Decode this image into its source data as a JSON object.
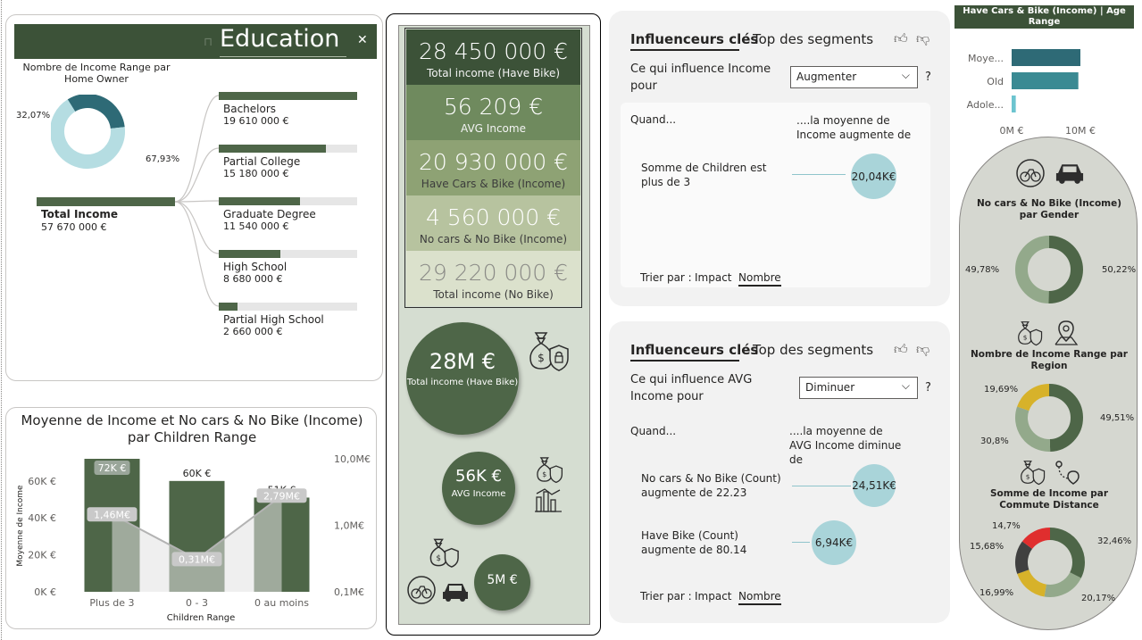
{
  "colors": {
    "dark_green": "#4e6648",
    "header_green": "#3c5238",
    "light_blue": "#b5dde2",
    "teal": "#2e6a76",
    "sage": "#93a98b",
    "gold": "#d7b22a",
    "charcoal": "#404040",
    "red": "#e02e2e"
  },
  "decomp": {
    "title": "Education",
    "subtitle": "Nombre de Income Range par Home Owner",
    "donut_left_pct": "32,07%",
    "donut_right_pct": "67,93%",
    "donut": [
      32.07,
      67.93
    ],
    "root": {
      "label": "Total Income",
      "value": "57 670 000 €"
    },
    "children": [
      {
        "label": "Bachelors",
        "value": "19 610 000 €",
        "fraction": 1.0
      },
      {
        "label": "Partial College",
        "value": "15 180 000 €",
        "fraction": 0.774
      },
      {
        "label": "Graduate Degree",
        "value": "11 540 000 €",
        "fraction": 0.588
      },
      {
        "label": "High School",
        "value": "8 680 000 €",
        "fraction": 0.443
      },
      {
        "label": "Partial High School",
        "value": "2 660 000 €",
        "fraction": 0.136
      }
    ],
    "icons": [
      "lock-icon",
      "close-icon"
    ]
  },
  "combo": {
    "title_line1": "Moyenne de Income et No cars & No Bike (Income)",
    "title_line2": "par Children Range",
    "ylabel": "Moyenne de Income",
    "xlabel": "Children Range",
    "left_ticks": [
      "60K €",
      "40K €",
      "20K €",
      "0K €"
    ],
    "right_ticks": [
      "10,0M€",
      "1,0M€",
      "0,1M€"
    ]
  },
  "chart_data": {
    "type": "bar",
    "title": "Moyenne de Income et No cars & No Bike (Income) par Children Range",
    "xlabel": "Children Range",
    "ylabel": "Moyenne de Income",
    "categories": [
      "Plus de 3",
      "0 - 3",
      "0 au moins"
    ],
    "series": [
      {
        "name": "Moyenne de Income",
        "values": [
          72000,
          60000,
          51000
        ],
        "labels": [
          "72K €",
          "60K €",
          "51K €"
        ]
      },
      {
        "name": "No cars & No Bike (Income)",
        "values": [
          1460000,
          310000,
          2790000
        ],
        "labels": [
          "1,46M€",
          "0,31M€",
          "2,79M€"
        ],
        "scale": "log"
      }
    ],
    "ylim": [
      0,
      72000
    ],
    "y2lim": [
      100000,
      10000000
    ]
  },
  "kpis": [
    {
      "value": "28 450 000 €",
      "label": "Total income (Have Bike)",
      "bg": "#3c5238"
    },
    {
      "value": "56 209 €",
      "label": "AVG Income",
      "bg": "#6f8a5e"
    },
    {
      "value": "20 930 000 €",
      "label": "Have Cars & Bike (Income)",
      "bg": "#8ea274"
    },
    {
      "value": "4 560 000 €",
      "label": "No cars & No Bike (Income)",
      "bg": "#b7c39f"
    },
    {
      "value": "29 220 000 €",
      "label": "Total income (No Bike)",
      "bg": "#dbe1cc"
    }
  ],
  "circles": [
    {
      "value": "28M €",
      "label": "Total income (Have Bike)"
    },
    {
      "value": "56K €",
      "label": "AVG Income"
    },
    {
      "value": "5M €",
      "label": ""
    }
  ],
  "influencers_top": {
    "tab1": "Influenceurs clés",
    "tab2": "Top des segments",
    "question": "Ce qui influence Income pour",
    "dropdown": "Augmenter",
    "help": "?",
    "when": "Quand...",
    "result_header": "....la moyenne de Income augmente de",
    "rows": [
      {
        "text": "Somme de Children est plus de 3",
        "value": "20,04K€"
      }
    ],
    "sort_label": "Trier par :",
    "sort_impact": "Impact",
    "sort_count": "Nombre"
  },
  "influencers_bottom": {
    "tab1": "Influenceurs clés",
    "tab2": "Top des segments",
    "question": "Ce qui influence AVG Income pour",
    "dropdown": "Diminuer",
    "help": "?",
    "when": "Quand...",
    "result_header": "....la moyenne de AVG Income diminue de",
    "rows": [
      {
        "text": "No cars & No Bike (Count) augmente de 22.23",
        "value": "24,51K€"
      },
      {
        "text": "Have Bike (Count) augmente de 80.14",
        "value": "6,94K€"
      }
    ],
    "sort_label": "Trier par :",
    "sort_impact": "Impact",
    "sort_count": "Nombre"
  },
  "age_chart": {
    "title": "Have Cars & Bike (Income) | Age Range",
    "categories": [
      "Moye...",
      "Old",
      "Adole..."
    ],
    "values": [
      10.0,
      9.7,
      0.6
    ],
    "ticks": [
      "0M €",
      "10M €"
    ]
  },
  "right_donuts": [
    {
      "title": "No cars & No Bike (Income) par Gender",
      "labels": [
        "49,78%",
        "50,22%"
      ],
      "values": [
        49.78,
        50.22
      ]
    },
    {
      "title": "Nombre de Income Range par Region",
      "labels": [
        "19,69%",
        "30,8%",
        "49,51%"
      ],
      "values": [
        19.69,
        30.8,
        49.51
      ]
    },
    {
      "title": "Somme de Income par Commute Distance",
      "labels": [
        "14,7%",
        "15,68%",
        "16,99%",
        "20,17%",
        "32,46%"
      ],
      "values": [
        14.7,
        15.68,
        16.99,
        20.17,
        32.46
      ]
    }
  ]
}
